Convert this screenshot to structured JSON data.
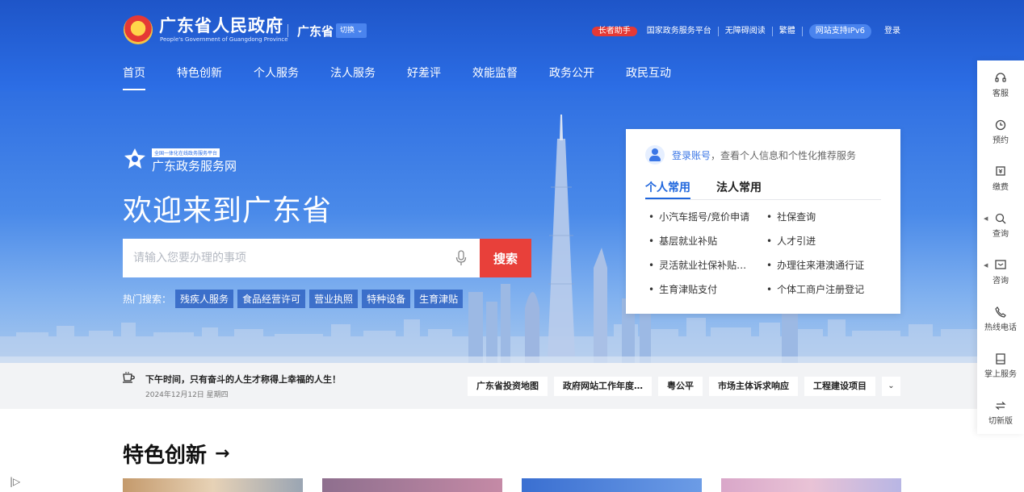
{
  "header": {
    "site_title": "广东省人民政府",
    "site_subtitle": "People's Government of Guangdong Province",
    "region": "广东省",
    "switch_label": "切换",
    "top_links": [
      "长者助手",
      "国家政务服务平台",
      "无障碍阅读",
      "繁體",
      "网站支持IPv6",
      "登录"
    ],
    "nav": [
      "首页",
      "特色创新",
      "个人服务",
      "法人服务",
      "好差评",
      "效能监督",
      "政务公开",
      "政民互动"
    ]
  },
  "hero": {
    "platform_tag": "全国一体化在线政务服务平台",
    "platform_name": "广东政务服务网",
    "welcome": "欢迎来到广东省",
    "search_placeholder": "请输入您要办理的事项",
    "search_button": "搜索",
    "hot_label": "热门搜索：",
    "hot_tags": [
      "残疾人服务",
      "食品经营许可",
      "营业执照",
      "特种设备",
      "生育津贴"
    ]
  },
  "card": {
    "login_link": "登录账号",
    "login_hint": "，查看个人信息和个性化推荐服务",
    "tabs": [
      "个人常用",
      "法人常用"
    ],
    "items": [
      "小汽车摇号/竞价申请",
      "社保查询",
      "基层就业补贴",
      "人才引进",
      "灵活就业社保补贴…",
      "办理往来港澳通行证",
      "生育津贴支付",
      "个体工商户注册登记"
    ]
  },
  "notice": {
    "slogan": "下午时间，只有奋斗的人生才称得上幸福的人生！",
    "date": "2024年12月12日 星期四",
    "quick_links": [
      "广东省投资地图",
      "政府网站工作年度…",
      "粤公平",
      "市场主体诉求响应",
      "工程建设项目"
    ]
  },
  "section": {
    "title": "特色创新"
  },
  "sidebar": {
    "items": [
      "客服",
      "预约",
      "缴费",
      "查询",
      "咨询",
      "热线电话",
      "掌上服务",
      "切新版"
    ]
  },
  "colors": {
    "brand_blue": "#2c6ee6",
    "search_red": "#e8403a",
    "elder_red": "#e53935"
  }
}
